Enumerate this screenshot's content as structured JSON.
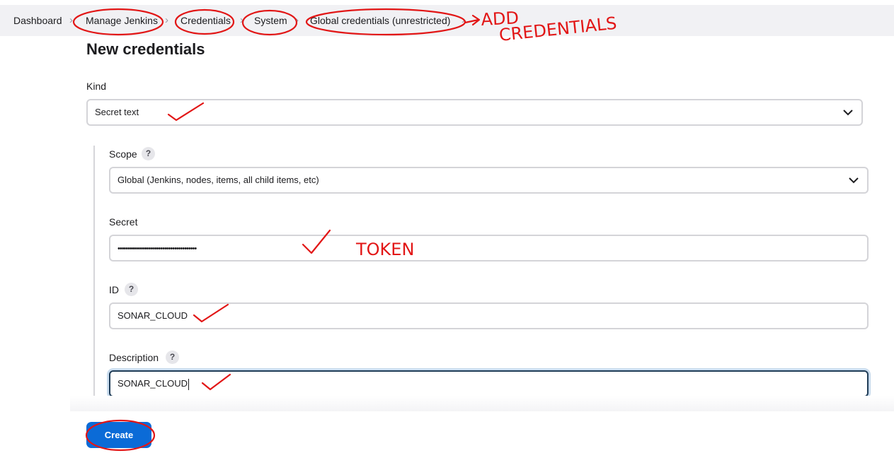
{
  "breadcrumb": {
    "items": [
      "Dashboard",
      "Manage Jenkins",
      "Credentials",
      "System",
      "Global credentials (unrestricted)"
    ]
  },
  "page": {
    "title": "New credentials"
  },
  "form": {
    "kind": {
      "label": "Kind",
      "value": "Secret text"
    },
    "scope": {
      "label": "Scope",
      "help": "?",
      "value": "Global (Jenkins, nodes, items, all child items, etc)"
    },
    "secret": {
      "label": "Secret",
      "value": "•••••••••••••••••••••••••••••••••••••••"
    },
    "id": {
      "label": "ID",
      "help": "?",
      "value": "SONAR_CLOUD"
    },
    "description": {
      "label": "Description",
      "help": "?",
      "value": "SONAR_CLOUD"
    },
    "create_label": "Create"
  },
  "annotations": {
    "add_line1": "ADD",
    "add_line2": "CREDENTIALS",
    "token": "TOKEN",
    "color": "#e21616"
  },
  "icons": {
    "separator": "chevron-right-icon",
    "dropdown": "chevron-down-icon",
    "help": "question-mark-icon"
  }
}
